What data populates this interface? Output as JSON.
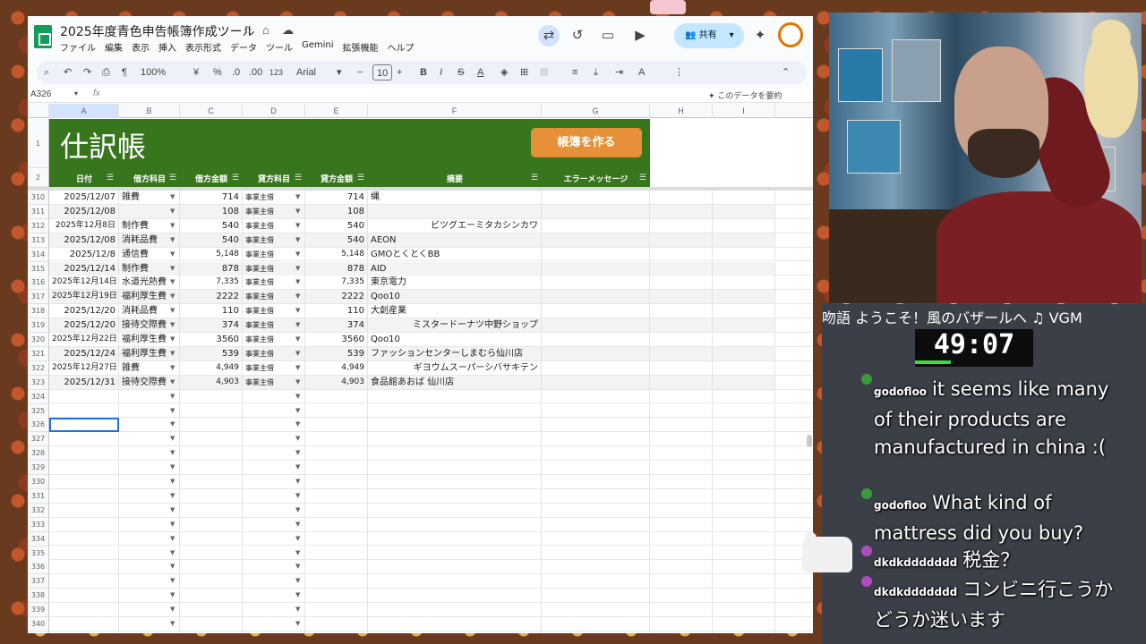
{
  "window": {
    "doc_title": "2025年度青色申告帳簿作成ツール",
    "menu": [
      "ファイル",
      "編集",
      "表示",
      "挿入",
      "表示形式",
      "データ",
      "ツール",
      "Gemini",
      "拡張機能",
      "ヘルプ"
    ],
    "share_label": "共有"
  },
  "toolbar": {
    "zoom": "100%",
    "currency": "¥",
    "percent": "%",
    "dec_less": ".0",
    "dec_more": ".00",
    "num_fmt": "123",
    "font": "Arial",
    "font_size": "10",
    "bold": "B",
    "italic": "I"
  },
  "formula_bar": {
    "namebox": "A326",
    "fx": "fx",
    "summarize_label": "このデータを要約"
  },
  "columns": [
    "A",
    "B",
    "C",
    "D",
    "E",
    "F",
    "G",
    "H",
    "I"
  ],
  "sheet": {
    "title": "仕訳帳",
    "button_label": "帳簿を作る",
    "headers": [
      "日付",
      "借方科目",
      "借方金額",
      "貸方科目",
      "貸方金額",
      "摘要",
      "エラーメッセージ"
    ]
  },
  "header_rows": [
    "1",
    "2"
  ],
  "rows": [
    {
      "n": "310",
      "date": "2025/12/07",
      "debit": "雑費",
      "damt": "714",
      "credit": "事業主借",
      "camt": "714",
      "memo": "縄"
    },
    {
      "n": "311",
      "date": "2025/12/08",
      "debit": "",
      "damt": "108",
      "credit": "事業主借",
      "camt": "108",
      "memo": ""
    },
    {
      "n": "312",
      "date": "2025年12月8日",
      "debit": "制作費",
      "damt": "540",
      "credit": "事業主借",
      "camt": "540",
      "memo": "ビツグエーミタカシンカワ"
    },
    {
      "n": "313",
      "date": "2025/12/08",
      "debit": "消耗品費",
      "damt": "540",
      "credit": "事業主借",
      "camt": "540",
      "memo": "AEON"
    },
    {
      "n": "314",
      "date": "2025/12/8",
      "debit": "通信費",
      "damt": "5,148",
      "credit": "事業主借",
      "camt": "5,148",
      "memo": "GMOとくとくBB"
    },
    {
      "n": "315",
      "date": "2025/12/14",
      "debit": "制作費",
      "damt": "878",
      "credit": "事業主借",
      "camt": "878",
      "memo": "AID"
    },
    {
      "n": "316",
      "date": "2025年12月14日",
      "debit": "水道光熱費",
      "damt": "7,335",
      "credit": "事業主借",
      "camt": "7,335",
      "memo": "東京電力"
    },
    {
      "n": "317",
      "date": "2025年12月19日",
      "debit": "福利厚生費",
      "damt": "2222",
      "credit": "事業主借",
      "camt": "2222",
      "memo": "Qoo10"
    },
    {
      "n": "318",
      "date": "2025/12/20",
      "debit": "消耗品費",
      "damt": "110",
      "credit": "事業主借",
      "camt": "110",
      "memo": "大創産業"
    },
    {
      "n": "319",
      "date": "2025/12/20",
      "debit": "接待交際費",
      "damt": "374",
      "credit": "事業主借",
      "camt": "374",
      "memo": "ミスタードーナツ中野ショップ"
    },
    {
      "n": "320",
      "date": "2025年12月22日",
      "debit": "福利厚生費",
      "damt": "3560",
      "credit": "事業主借",
      "camt": "3560",
      "memo": "Qoo10"
    },
    {
      "n": "321",
      "date": "2025/12/24",
      "debit": "福利厚生費",
      "damt": "539",
      "credit": "事業主借",
      "camt": "539",
      "memo": "ファッションセンターしまむら仙川店"
    },
    {
      "n": "322",
      "date": "2025年12月27日",
      "debit": "雑費",
      "damt": "4,949",
      "credit": "事業主借",
      "camt": "4,949",
      "memo": "ギヨウムスーパーシバサキテン"
    },
    {
      "n": "323",
      "date": "2025/12/31",
      "debit": "接待交際費",
      "damt": "4,903",
      "credit": "事業主借",
      "camt": "4,903",
      "memo": "食品館あおば 仙川店"
    }
  ],
  "empty_rows": [
    "324",
    "325",
    "326",
    "327",
    "328",
    "329",
    "330",
    "331",
    "332",
    "333",
    "334",
    "335",
    "336",
    "337",
    "338",
    "339",
    "340",
    "341"
  ],
  "stream": {
    "song": "吻語  ようこそ！風のバザールへ      ♫ VGM",
    "timer": "49:07",
    "chat": [
      {
        "user": "godofloo",
        "text": "it seems like many of their products are manufactured in china :("
      },
      {
        "user": "godofloo",
        "text": "What kind of mattress did you buy?"
      },
      {
        "user": "dkdkddddddd",
        "text": "税金？"
      },
      {
        "user": "dkdkddddddd",
        "text": "コンビニ行こうかどうか迷います"
      }
    ]
  },
  "colors": {
    "header_green": "#38761d",
    "button_orange": "#e69138",
    "share_blue": "#c2e7ff"
  }
}
